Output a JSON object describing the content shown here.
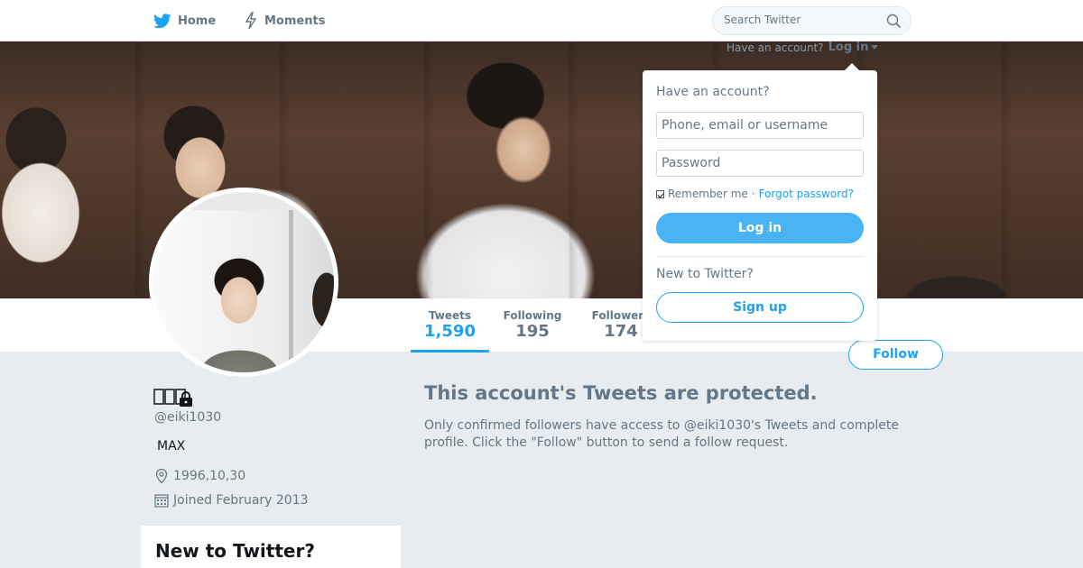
{
  "nav": {
    "home_label": "Home",
    "moments_label": "Moments",
    "home_icon": "twitter-bird-icon",
    "moments_icon": "lightning-icon",
    "accent": "#1da1f2"
  },
  "search": {
    "placeholder": "Search Twitter",
    "icon": "search-icon"
  },
  "login_trigger": {
    "prompt": "Have an account?",
    "link": "Log in"
  },
  "login_dropdown": {
    "heading": "Have an account?",
    "username_placeholder": "Phone, email or username",
    "password_placeholder": "Password",
    "remember_label": "Remember me",
    "separator": "·",
    "forgot_label": "Forgot password?",
    "login_button": "Log in",
    "new_prompt": "New to Twitter?",
    "signup_button": "Sign up"
  },
  "stats": [
    {
      "label": "Tweets",
      "value": "1,590",
      "active": true
    },
    {
      "label": "Following",
      "value": "195"
    },
    {
      "label": "Followers",
      "value": "174"
    }
  ],
  "follow_button": "Follow",
  "profile": {
    "name": "",
    "handle": "@eiki1030",
    "bio": "MAX",
    "location": "1996,10,30",
    "joined": "Joined February 2013",
    "protected": true
  },
  "protected_notice": {
    "title": "This account's Tweets are protected.",
    "text": "Only confirmed followers have access to @eiki1030's Tweets and complete profile. Click the \"Follow\" button to send a follow request."
  },
  "signup_module": {
    "title": "New to Twitter?"
  }
}
